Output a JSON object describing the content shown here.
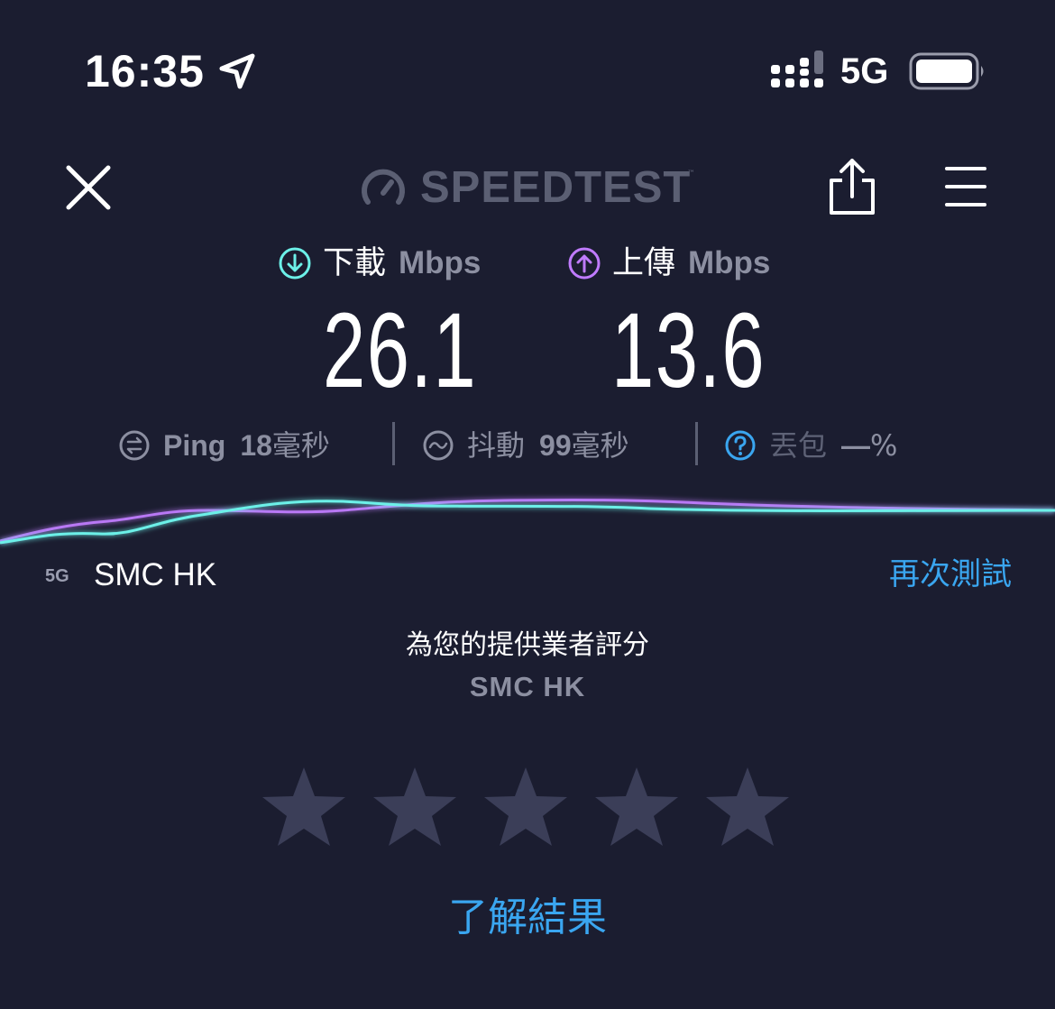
{
  "status_bar": {
    "time": "16:35",
    "network": "5G",
    "icons": [
      "location-arrow-icon",
      "cellular-signal-icon",
      "battery-icon"
    ]
  },
  "header": {
    "logo_text": "SPEEDTEST",
    "logo_mark": "™",
    "icons": [
      "close-icon",
      "speedometer-icon",
      "share-icon",
      "menu-icon"
    ]
  },
  "download": {
    "label": "下載",
    "unit": "Mbps",
    "value": "26.1",
    "color": "#6cf0e8"
  },
  "upload": {
    "label": "上傳",
    "unit": "Mbps",
    "value": "13.6",
    "color": "#c07bff"
  },
  "metrics": {
    "ping": {
      "label": "Ping",
      "value": "18",
      "unit": "毫秒"
    },
    "jitter": {
      "label": "抖動",
      "value": "99",
      "unit": "毫秒"
    },
    "loss": {
      "label": "丟包",
      "value": "—",
      "unit": "%"
    }
  },
  "provider": {
    "network_badge": "5G",
    "name": "SMC HK",
    "retest_label": "再次測試"
  },
  "rating": {
    "title": "為您的提供業者評分",
    "provider": "SMC HK",
    "star_count": 5,
    "selected": 0
  },
  "results_link": "了解結果",
  "colors": {
    "background": "#1b1d30",
    "accent_blue": "#3aa6f0",
    "muted": "#8c8fa1",
    "star": "#3b3e58"
  }
}
